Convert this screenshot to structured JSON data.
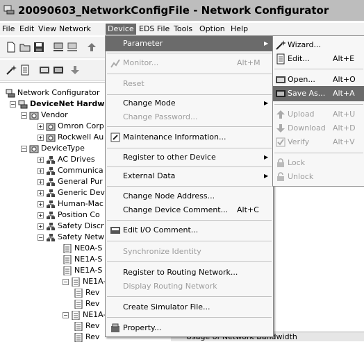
{
  "window": {
    "title": "20090603_NetworkConfigFile - Network Configurator"
  },
  "menubar": {
    "items": [
      "File",
      "Edit",
      "View",
      "Network",
      "Device",
      "EDS File",
      "Tools",
      "Option",
      "Help"
    ]
  },
  "tree": {
    "root": "Network Configurator",
    "network": "DeviceNet Hardw",
    "vendor": "Vendor",
    "vendors": [
      "Omron Corp",
      "Rockwell Au"
    ],
    "devicetype": "DeviceType",
    "types": [
      "AC Drives",
      "Communica",
      "General Pur",
      "Generic Dev",
      "Human-Mac",
      "Position Co",
      "Safety Discr",
      "Safety Netw"
    ],
    "safety_children": [
      "NE0A-S",
      "NE1A-S",
      "NE1A-S",
      "NE1A-S",
      "Rev",
      "Rev",
      "NE1A-S",
      "Rev",
      "Rev"
    ]
  },
  "device_menu": {
    "parameter": "Parameter",
    "monitor": "Monitor...",
    "monitor_sc": "Alt+M",
    "reset": "Reset",
    "change_mode": "Change Mode",
    "change_password": "Change Password...",
    "maintenance": "Maintenance Information...",
    "register_other": "Register to other Device",
    "external_data": "External Data",
    "change_node": "Change Node Address...",
    "change_comment": "Change Device Comment...",
    "change_comment_sc": "Alt+C",
    "edit_io": "Edit I/O Comment...",
    "sync_identity": "Synchronize Identity",
    "register_routing": "Register to Routing Network...",
    "display_routing": "Display Routing Network",
    "create_sim": "Create Simulator File...",
    "property": "Property..."
  },
  "parameter_submenu": {
    "wizard": "Wizard...",
    "edit": "Edit...",
    "edit_sc": "Alt+E",
    "open": "Open...",
    "open_sc": "Alt+O",
    "save_as": "Save As...",
    "save_as_sc": "Alt+A",
    "upload": "Upload",
    "upload_sc": "Alt+U",
    "download": "Download",
    "download_sc": "Alt+D",
    "verify": "Verify",
    "verify_sc": "Alt+V",
    "lock": "Lock",
    "unlock": "Unlock"
  },
  "bottom": {
    "tab": "Usage of Network Bandwidth"
  }
}
